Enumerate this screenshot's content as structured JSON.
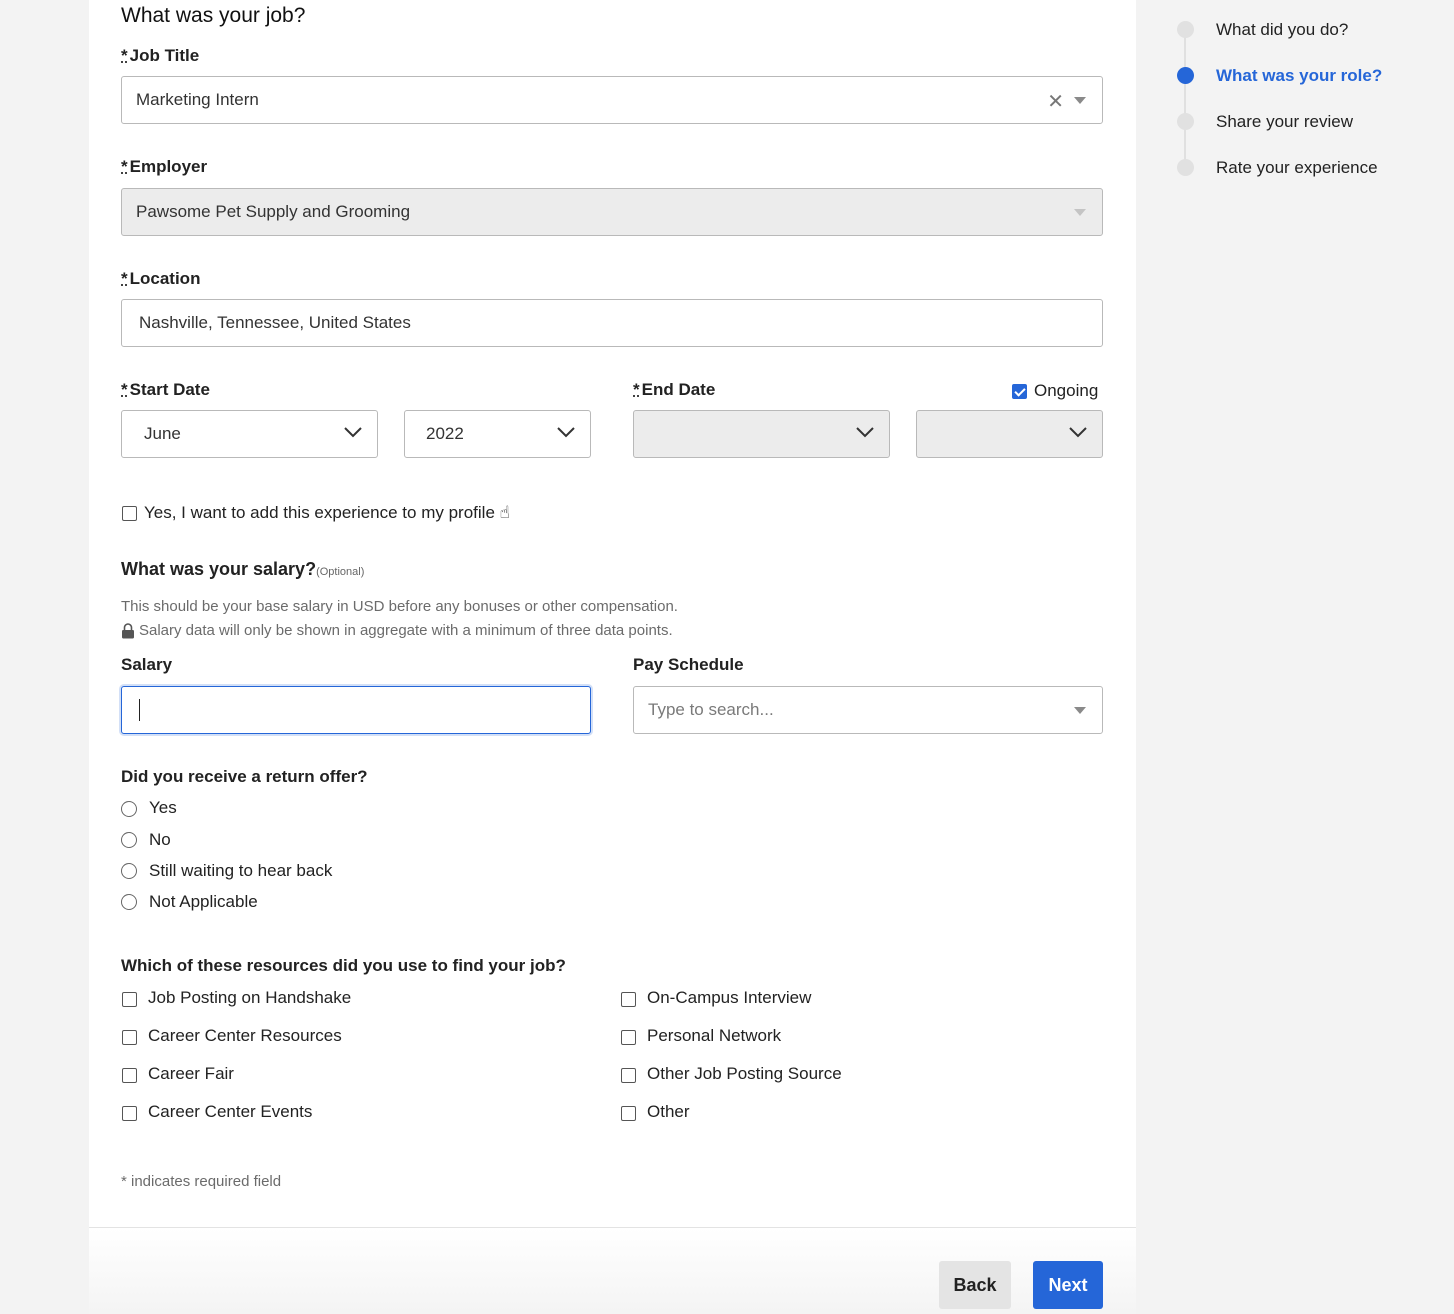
{
  "form": {
    "section_title": "What was your job?",
    "required_marker": "*",
    "job_title": {
      "label": "Job Title",
      "value": "Marketing Intern",
      "clear_icon": "close-icon"
    },
    "employer": {
      "label": "Employer",
      "value": "Pawsome Pet Supply and Grooming"
    },
    "location": {
      "label": "Location",
      "value": "Nashville, Tennessee, United States"
    },
    "start_date": {
      "label": "Start Date",
      "month": "June",
      "year": "2022"
    },
    "end_date": {
      "label": "End Date",
      "month": "",
      "year": "",
      "ongoing_label": "Ongoing",
      "ongoing_checked": true
    },
    "add_to_profile": {
      "label": "Yes, I want to add this experience to my profile ☝",
      "checked": false
    },
    "salary_section": {
      "title": "What was your salary?",
      "optional": "(Optional)",
      "help_1": "This should be your base salary in USD before any bonuses or other compensation.",
      "help_2": "Salary data will only be shown in aggregate with a minimum of three data points.",
      "salary_label": "Salary",
      "salary_value": "",
      "pay_schedule_label": "Pay Schedule",
      "pay_schedule_placeholder": "Type to search..."
    },
    "return_offer": {
      "title": "Did you receive a return offer?",
      "options": [
        "Yes",
        "No",
        "Still waiting to hear back",
        "Not Applicable"
      ]
    },
    "resources": {
      "title": "Which of these resources did you use to find your job?",
      "left": [
        "Job Posting on Handshake",
        "Career Center Resources",
        "Career Fair",
        "Career Center Events"
      ],
      "right": [
        "On-Campus Interview",
        "Personal Network",
        "Other Job Posting Source",
        "Other"
      ]
    },
    "required_note": "* indicates required field"
  },
  "footer": {
    "back_label": "Back",
    "next_label": "Next"
  },
  "steps": [
    {
      "label": "What did you do?",
      "active": false
    },
    {
      "label": "What was your role?",
      "active": true
    },
    {
      "label": "Share your review",
      "active": false
    },
    {
      "label": "Rate your experience",
      "active": false
    }
  ],
  "colors": {
    "accent": "#2566d8"
  }
}
